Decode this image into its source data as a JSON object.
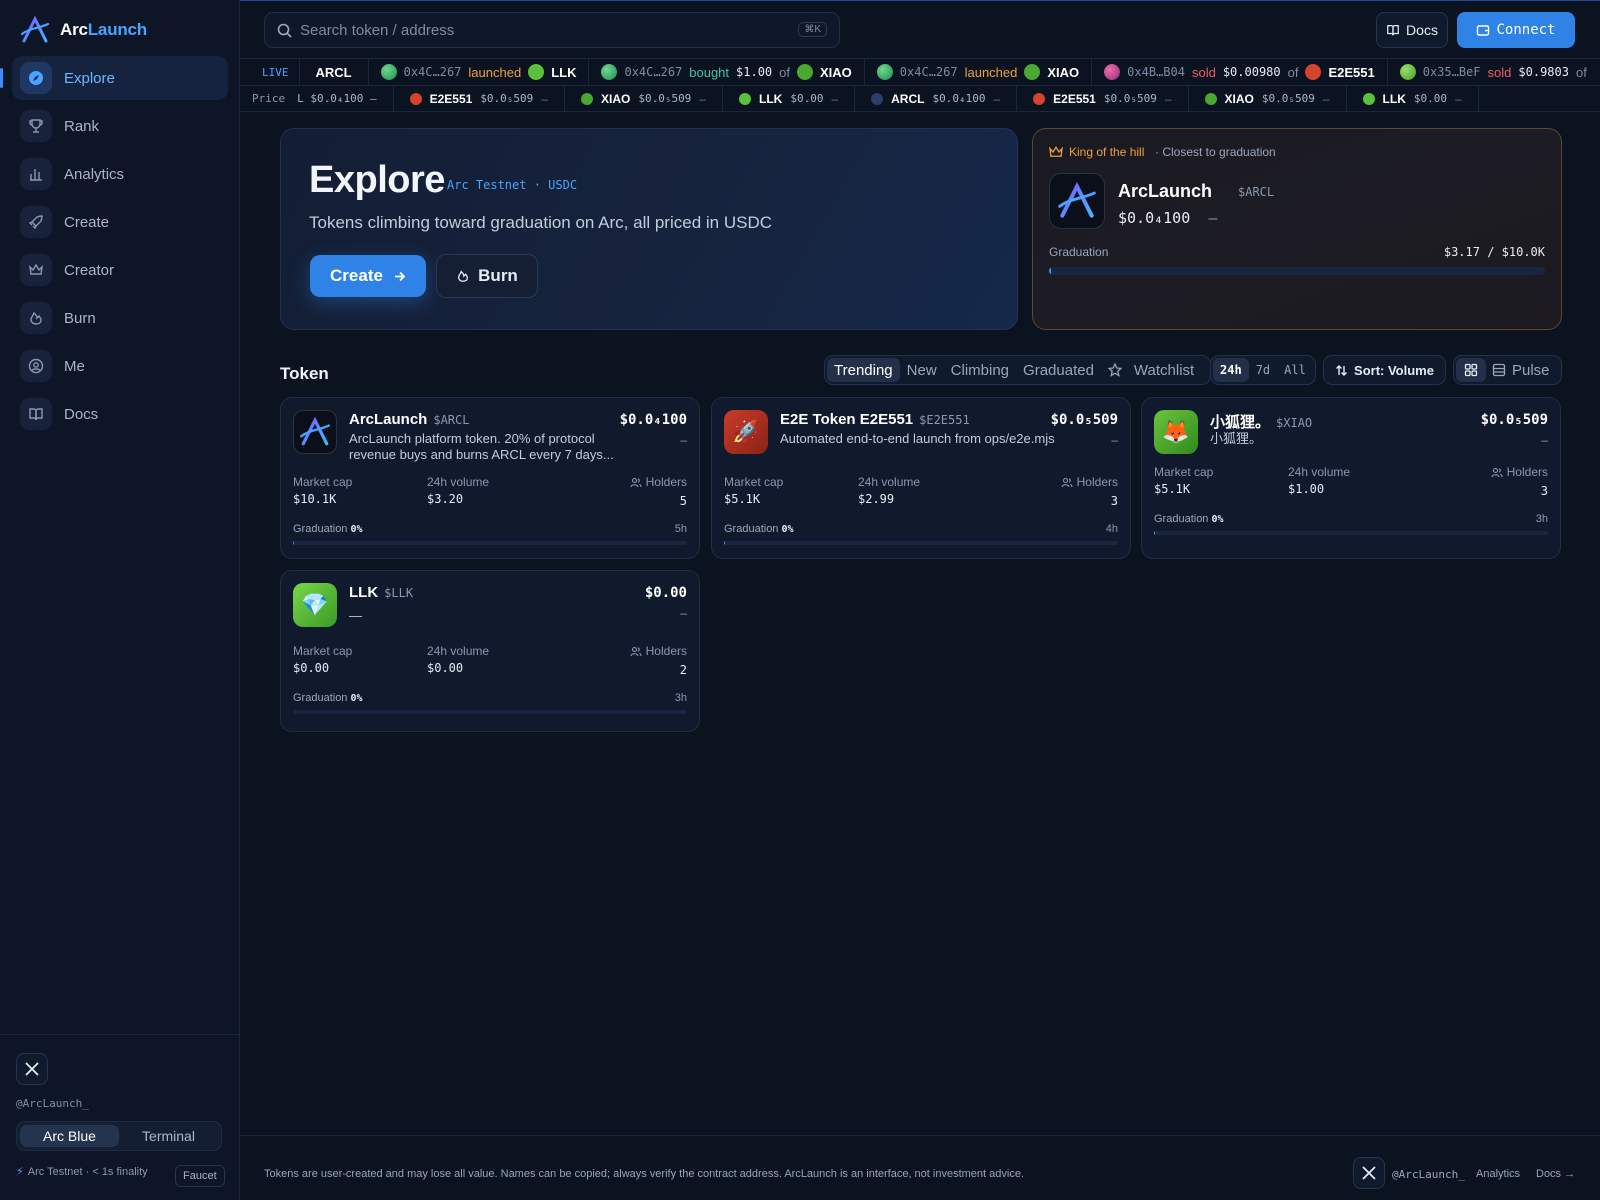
{
  "brand": {
    "name_part1": "Arc",
    "name_part2": "Launch"
  },
  "sidebar": {
    "items": [
      {
        "label": "Explore",
        "icon": "compass-icon",
        "active": true
      },
      {
        "label": "Rank",
        "icon": "trophy-icon"
      },
      {
        "label": "Analytics",
        "icon": "bar-chart-icon"
      },
      {
        "label": "Create",
        "icon": "rocket-icon"
      },
      {
        "label": "Creator",
        "icon": "crown-icon"
      },
      {
        "label": "Burn",
        "icon": "flame-icon"
      },
      {
        "label": "Me",
        "icon": "user-circle-icon"
      },
      {
        "label": "Docs",
        "icon": "book-icon"
      }
    ],
    "handle": "@ArcLaunch_",
    "theme_options": [
      "Arc Blue",
      "Terminal"
    ],
    "theme_selected": "Arc Blue",
    "network_status": "Arc Testnet · < 1s finality",
    "faucet_label": "Faucet"
  },
  "header": {
    "search_placeholder": "Search token / address",
    "search_shortcut": "⌘K",
    "docs_label": "Docs",
    "connect_label": "Connect"
  },
  "ticker": {
    "live_label": "LIVE",
    "pinned_symbol": "ARCL",
    "events": [
      {
        "addr": "0x4C…267",
        "action": "launched",
        "amount": "",
        "token": "LLK"
      },
      {
        "addr": "0x4C…267",
        "action": "bought",
        "amount": "$1.00",
        "of": "of",
        "token": "XIAO"
      },
      {
        "addr": "0x4C…267",
        "action": "launched",
        "amount": "",
        "token": "XIAO"
      },
      {
        "addr": "0x4B…B04",
        "action": "sold",
        "amount": "$0.00980",
        "of": "of",
        "token": "E2E551"
      },
      {
        "addr": "0x35…BeF",
        "action": "sold",
        "amount": "$0.9803",
        "of": "of",
        "token": ""
      }
    ],
    "price_label": "Price",
    "price_lead": "L  $0.0₄100  –",
    "prices": [
      {
        "symbol": "E2E551",
        "value": "$0.0₅509",
        "change": "–"
      },
      {
        "symbol": "XIAO",
        "value": "$0.0₅509",
        "change": "–"
      },
      {
        "symbol": "LLK",
        "value": "$0.00",
        "change": "–"
      },
      {
        "symbol": "ARCL",
        "value": "$0.0₄100",
        "change": "–"
      },
      {
        "symbol": "E2E551",
        "value": "$0.0₅509",
        "change": "–"
      },
      {
        "symbol": "XIAO",
        "value": "$0.0₅509",
        "change": "–"
      },
      {
        "symbol": "LLK",
        "value": "$0.00",
        "change": "–"
      }
    ]
  },
  "hero": {
    "title": "Explore",
    "tag": "Arc Testnet · USDC",
    "subtitle": "Tokens climbing toward graduation on Arc, all priced in USDC",
    "create_label": "Create",
    "burn_label": "Burn"
  },
  "king": {
    "label": "King of the hill",
    "sublabel": "· Closest to graduation",
    "name": "ArcLaunch",
    "symbol": "$ARCL",
    "price": "$0.0₄100",
    "change": "–",
    "grad_label": "Graduation",
    "grad_value": "$3.17 / $10.0K",
    "grad_fraction": 0.0032
  },
  "section": {
    "title": "Token",
    "tabs": [
      "Trending",
      "New",
      "Climbing",
      "Graduated",
      "Watchlist"
    ],
    "tab_selected": "Trending",
    "ranges": [
      "24h",
      "7d",
      "All"
    ],
    "range_selected": "24h",
    "sort_label": "Sort: Volume",
    "view_pulse_label": "Pulse"
  },
  "tokens": [
    {
      "name": "ArcLaunch",
      "symbol": "$ARCL",
      "desc": "ArcLaunch platform token. 20% of protocol revenue buys and burns ARCL every 7 days...",
      "price": "$0.0₄100",
      "change": "–",
      "mcap_label": "Market cap",
      "mcap": "$10.1K",
      "vol_label": "24h volume",
      "vol": "$3.20",
      "holders_label": "Holders",
      "holders": "5",
      "grad_label": "Graduation",
      "grad": "0%",
      "age": "5h",
      "grad_fraction": 0.003
    },
    {
      "name": "E2E Token E2E551",
      "symbol": "$E2E551",
      "desc": "Automated end-to-end launch from ops/e2e.mjs",
      "price": "$0.0₅509",
      "change": "–",
      "mcap_label": "Market cap",
      "mcap": "$5.1K",
      "vol_label": "24h volume",
      "vol": "$2.99",
      "holders_label": "Holders",
      "holders": "3",
      "grad_label": "Graduation",
      "grad": "0%",
      "age": "4h",
      "grad_fraction": 0.003
    },
    {
      "name": "小狐狸。",
      "symbol": "$XIAO",
      "desc": "小狐狸。",
      "price": "$0.0₅509",
      "change": "–",
      "mcap_label": "Market cap",
      "mcap": "$5.1K",
      "vol_label": "24h volume",
      "vol": "$1.00",
      "holders_label": "Holders",
      "holders": "3",
      "grad_label": "Graduation",
      "grad": "0%",
      "age": "3h",
      "grad_fraction": 0.003
    },
    {
      "name": "LLK",
      "symbol": "$LLK",
      "desc": "—",
      "price": "$0.00",
      "change": "–",
      "mcap_label": "Market cap",
      "mcap": "$0.00",
      "vol_label": "24h volume",
      "vol": "$0.00",
      "holders_label": "Holders",
      "holders": "2",
      "grad_label": "Graduation",
      "grad": "0%",
      "age": "3h",
      "grad_fraction": 0.0
    }
  ],
  "footer": {
    "disclaimer": "Tokens are user-created and may lose all value. Names can be copied; always verify the contract address. ArcLaunch is an interface, not investment advice.",
    "handle": "@ArcLaunch_",
    "analytics": "Analytics",
    "docs": "Docs →"
  },
  "colors": {
    "accent": "#2f83e6",
    "launched": "#f0a13b",
    "bought": "#3fc6a0",
    "sold": "#f15b6c",
    "king_border": "#5a4a2c"
  }
}
